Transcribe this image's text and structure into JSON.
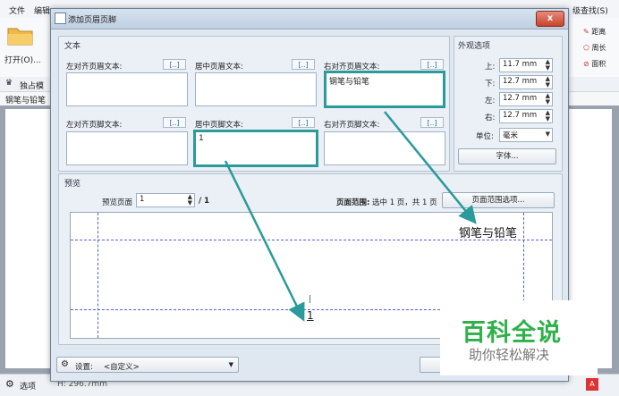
{
  "app": {
    "menu": [
      "文件",
      "编辑"
    ],
    "open_label": "打开(O)...",
    "side_tab": "独占模",
    "doc_tab": "钢笔与铅笔",
    "right_menu": "级查找(S)",
    "right_tools": [
      "距离",
      "周长",
      "面积"
    ],
    "status_left": "选项",
    "status_mid": "H: 296.7mm"
  },
  "dialog": {
    "title": "添加页眉页脚",
    "close_label": "x",
    "text_group": "文本",
    "insert_label": "[..]",
    "header_fields": [
      {
        "label": "左对齐页眉文本:",
        "value": ""
      },
      {
        "label": "居中页眉文本:",
        "value": ""
      },
      {
        "label": "右对齐页眉文本:",
        "value": "钢笔与铅笔"
      }
    ],
    "footer_fields": [
      {
        "label": "左对齐页脚文本:",
        "value": ""
      },
      {
        "label": "居中页脚文本:",
        "value": "1"
      },
      {
        "label": "右对齐页脚文本:",
        "value": ""
      }
    ],
    "appearance": {
      "title": "外观选项",
      "top_label": "上:",
      "top": "11.7 mm",
      "bottom_label": "下:",
      "bottom": "12.7 mm",
      "left_label": "左:",
      "left": "12.7 mm",
      "right_label": "右:",
      "right": "12.7 mm",
      "unit_label": "单位:",
      "unit": "毫米",
      "font_button": "字体..."
    },
    "preview": {
      "title": "预览",
      "page_label": "预览页面",
      "page_value": "1",
      "page_total": "/ 1",
      "range_label": "页面范围:",
      "range_text": "选中 1 页，共 1 页",
      "range_button": "页面范围选项...",
      "header_text": "钢笔与铅笔",
      "footer_text": "1"
    },
    "settings_label": "设置:",
    "settings_value": "<自定义>"
  },
  "watermark": {
    "title": "百科全说",
    "subtitle": "助你轻松解决"
  },
  "colors": {
    "highlight": "#2a9a9a",
    "watermark_green": "#2fb14a"
  }
}
